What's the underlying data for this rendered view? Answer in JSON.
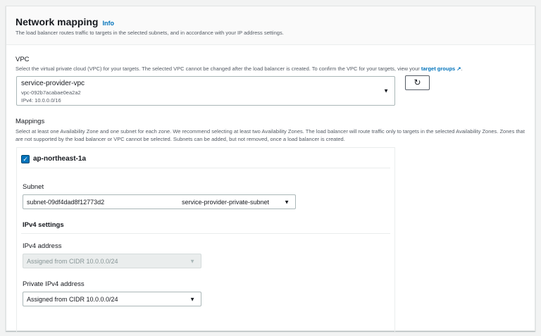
{
  "header": {
    "title": "Network mapping",
    "info": "Info",
    "description": "The load balancer routes traffic to targets in the selected subnets, and in accordance with your IP address settings."
  },
  "vpc": {
    "label": "VPC",
    "description": "Select the virtual private cloud (VPC) for your targets. The selected VPC cannot be changed after the load balancer is created. To confirm the VPC for your targets, view your",
    "link": "target groups",
    "name": "service-provider-vpc",
    "id": "vpc-092b7acabae0ea2a2",
    "cidr": "IPv4: 10.0.0.0/16"
  },
  "mappings": {
    "label": "Mappings",
    "description": "Select at least one Availability Zone and one subnet for each zone. We recommend selecting at least two Availability Zones. The load balancer will route traffic only to targets in the selected Availability Zones. Zones that are not supported by the load balancer or VPC cannot be selected. Subnets can be added, but not removed, once a load balancer is created.",
    "zone": {
      "name": "ap-northeast-1a",
      "checked": true,
      "subnet_label": "Subnet",
      "subnet_id": "subnet-09df4dad8f12773d2",
      "subnet_name": "service-provider-private-subnet",
      "ipv4_settings": "IPv4 settings",
      "ipv4_address_label": "IPv4 address",
      "ipv4_address_value": "Assigned from CIDR 10.0.0.0/24",
      "private_ipv4_label": "Private IPv4 address",
      "private_ipv4_value": "Assigned from CIDR 10.0.0.0/24"
    }
  }
}
